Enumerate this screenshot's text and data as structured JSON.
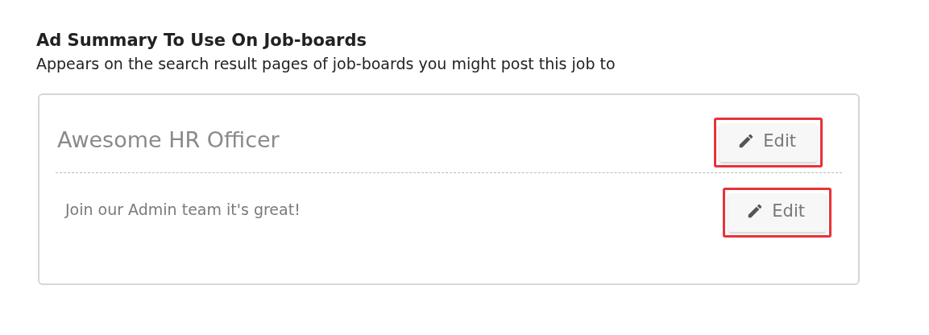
{
  "heading": "Ad Summary To Use On Job-boards",
  "subheading": "Appears on the search result pages of job-boards you might post this job to",
  "card": {
    "rows": [
      {
        "kind": "title",
        "text": "Awesome HR Officer",
        "edit": {
          "label": "Edit",
          "highlighted": true
        }
      },
      {
        "kind": "summary",
        "text": "Join our Admin team it's great!",
        "edit": {
          "label": "Edit",
          "highlighted": true
        }
      }
    ]
  }
}
